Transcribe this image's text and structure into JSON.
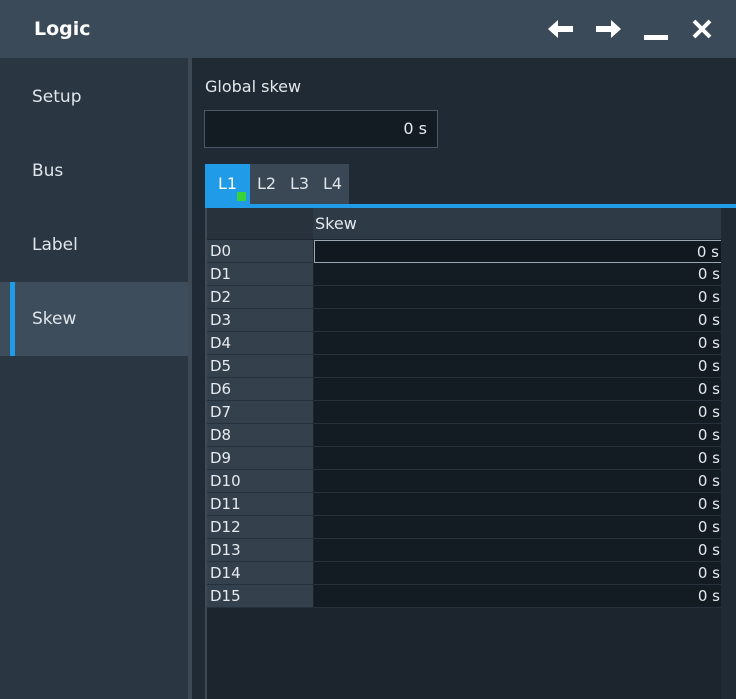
{
  "window": {
    "title": "Logic",
    "buttons": [
      {
        "name": "back-button",
        "icon": "arrow-left-icon"
      },
      {
        "name": "forward-button",
        "icon": "arrow-right-icon"
      },
      {
        "name": "minimize-button",
        "icon": "minimize-icon"
      },
      {
        "name": "close-button",
        "icon": "close-icon"
      }
    ]
  },
  "sidebar": {
    "items": [
      {
        "label": "Setup",
        "active": false
      },
      {
        "label": "Bus",
        "active": false
      },
      {
        "label": "Label",
        "active": false
      },
      {
        "label": "Skew",
        "active": true
      }
    ]
  },
  "global_skew": {
    "label": "Global skew",
    "value": "0 s"
  },
  "tabs": [
    {
      "label": "L1",
      "active": true,
      "indicator_color": "#3ad23a"
    },
    {
      "label": "L2",
      "active": false
    },
    {
      "label": "L3",
      "active": false
    },
    {
      "label": "L4",
      "active": false
    }
  ],
  "table": {
    "column_header": "Skew",
    "rows": [
      {
        "label": "D0",
        "value": "0 s",
        "editing": true
      },
      {
        "label": "D1",
        "value": "0 s"
      },
      {
        "label": "D2",
        "value": "0 s"
      },
      {
        "label": "D3",
        "value": "0 s"
      },
      {
        "label": "D4",
        "value": "0 s"
      },
      {
        "label": "D5",
        "value": "0 s"
      },
      {
        "label": "D6",
        "value": "0 s"
      },
      {
        "label": "D7",
        "value": "0 s"
      },
      {
        "label": "D8",
        "value": "0 s"
      },
      {
        "label": "D9",
        "value": "0 s"
      },
      {
        "label": "D10",
        "value": "0 s"
      },
      {
        "label": "D11",
        "value": "0 s"
      },
      {
        "label": "D12",
        "value": "0 s"
      },
      {
        "label": "D13",
        "value": "0 s"
      },
      {
        "label": "D14",
        "value": "0 s"
      },
      {
        "label": "D15",
        "value": "0 s"
      }
    ]
  },
  "colors": {
    "accent": "#1f9be8",
    "active_indicator": "#3ad23a"
  }
}
